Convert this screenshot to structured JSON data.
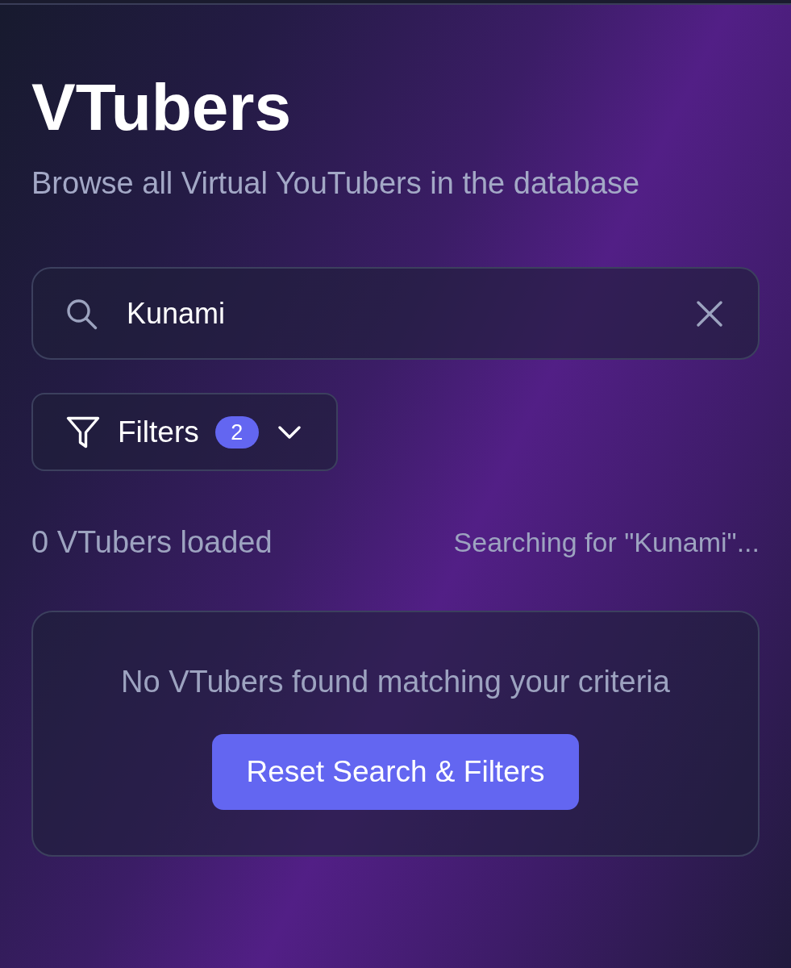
{
  "header": {
    "title": "VTubers",
    "subtitle": "Browse all Virtual YouTubers in the database"
  },
  "search": {
    "value": "Kunami"
  },
  "filters": {
    "label": "Filters",
    "count": "2",
    "expanded": false
  },
  "status": {
    "loaded": "0 VTubers loaded",
    "searching": "Searching for \"Kunami\"..."
  },
  "empty_state": {
    "message": "No VTubers found matching your criteria",
    "button": "Reset Search & Filters"
  }
}
